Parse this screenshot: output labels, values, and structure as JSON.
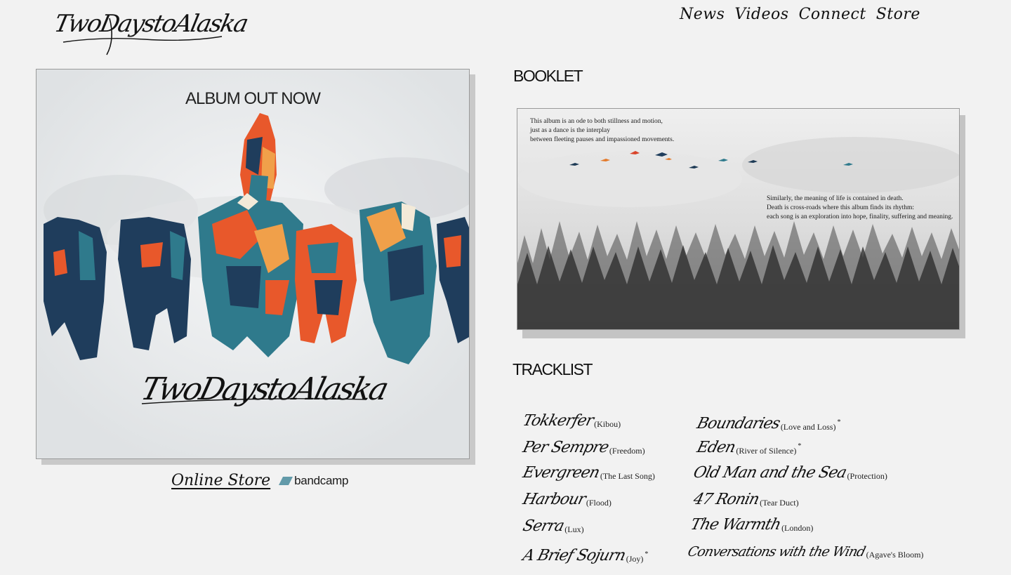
{
  "brand": {
    "logo_text": "TwoDaystoAlaska"
  },
  "nav": {
    "items": [
      {
        "label": "News"
      },
      {
        "label": "Videos"
      },
      {
        "label": "Connect"
      },
      {
        "label": "Store"
      }
    ]
  },
  "album": {
    "headline": "ALBUM OUT NOW",
    "cover_logo_text": "TwoDaystoAlaska",
    "colors": {
      "navy": "#1f3d5c",
      "teal": "#2f7a8c",
      "orange": "#e8582b",
      "amber": "#f0a04a",
      "cream": "#f3ead8"
    }
  },
  "store": {
    "online_store_label": "Online Store",
    "bandcamp_label": "bandcamp",
    "bandcamp_color": "#629aa9"
  },
  "booklet": {
    "title": "BOOKLET",
    "text_top": [
      "This album is an ode to both stillness and motion,",
      "just as a dance is the interplay",
      "between fleeting pauses and impassioned movements."
    ],
    "text_right": [
      "Similarly, the meaning of life is contained in death.",
      "Death is cross-roads where this album finds its rhythm:",
      "each song is an exploration into hope, finality, suffering and meaning."
    ]
  },
  "tracklist": {
    "title": "TRACKLIST",
    "left": [
      {
        "title": "Tokkerfer",
        "meaning": "(Kibou)",
        "asterisk": ""
      },
      {
        "title": "Per Sempre",
        "meaning": "(Freedom)",
        "asterisk": ""
      },
      {
        "title": "Evergreen",
        "meaning": "(The Last Song)",
        "asterisk": ""
      },
      {
        "title": "Harbour",
        "meaning": "(Flood)",
        "asterisk": ""
      },
      {
        "title": "Serra",
        "meaning": "(Lux)",
        "asterisk": ""
      },
      {
        "title": "A Brief Sojurn",
        "meaning": "(Joy)",
        "asterisk": "*"
      }
    ],
    "right": [
      {
        "title": "Boundaries",
        "meaning": "(Love and Loss)",
        "asterisk": "*"
      },
      {
        "title": "Eden",
        "meaning": "(River of Silence)",
        "asterisk": "*"
      },
      {
        "title": "Old Man and the Sea",
        "meaning": "(Protection)",
        "asterisk": ""
      },
      {
        "title": "47 Ronin",
        "meaning": "(Tear Duct)",
        "asterisk": ""
      },
      {
        "title": "The Warmth",
        "meaning": "(London)",
        "asterisk": ""
      },
      {
        "title": "Conversations with the Wind",
        "meaning": "(Agave's Bloom)",
        "asterisk": ""
      }
    ]
  }
}
